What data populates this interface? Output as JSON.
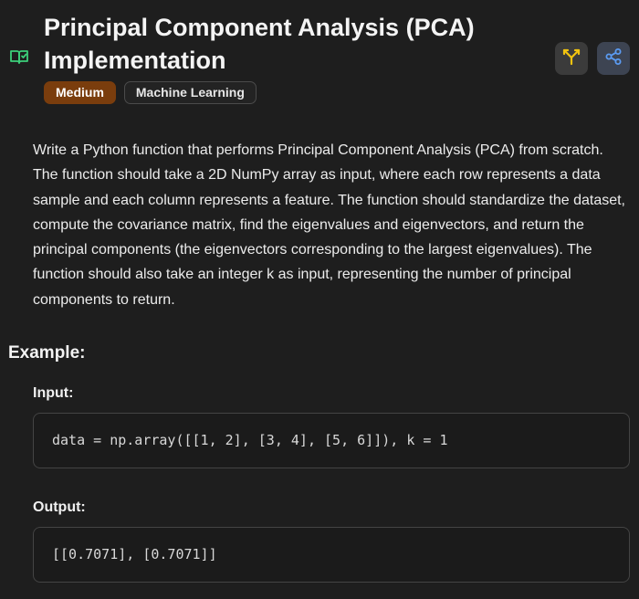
{
  "problem": {
    "title": "Principal Component Analysis (PCA) Implementation",
    "difficulty": "Medium",
    "category": "Machine Learning",
    "description": "Write a Python function that performs Principal Component Analysis (PCA) from scratch. The function should take a 2D NumPy array as input, where each row represents a data sample and each column represents a feature. The function should standardize the dataset, compute the covariance matrix, find the eigenvalues and eigenvectors, and return the principal components (the eigenvectors corresponding to the largest eigenvalues). The function should also take an integer k as input, representing the number of principal components to return."
  },
  "example": {
    "heading": "Example:",
    "input_label": "Input:",
    "input_code": "data = np.array([[1, 2], [3, 4], [5, 6]]), k = 1",
    "output_label": "Output:",
    "output_code": "[[0.7071], [0.7071]]"
  },
  "icons": {
    "book": "book-open-icon",
    "fork": "git-fork-icon",
    "share": "share-icon"
  },
  "colors": {
    "background": "#1e1e1e",
    "difficulty_badge": "#7a3d0d",
    "book_icon": "#3ccf7a",
    "fork_icon": "#f2c40f",
    "share_icon": "#5b9bf2"
  }
}
